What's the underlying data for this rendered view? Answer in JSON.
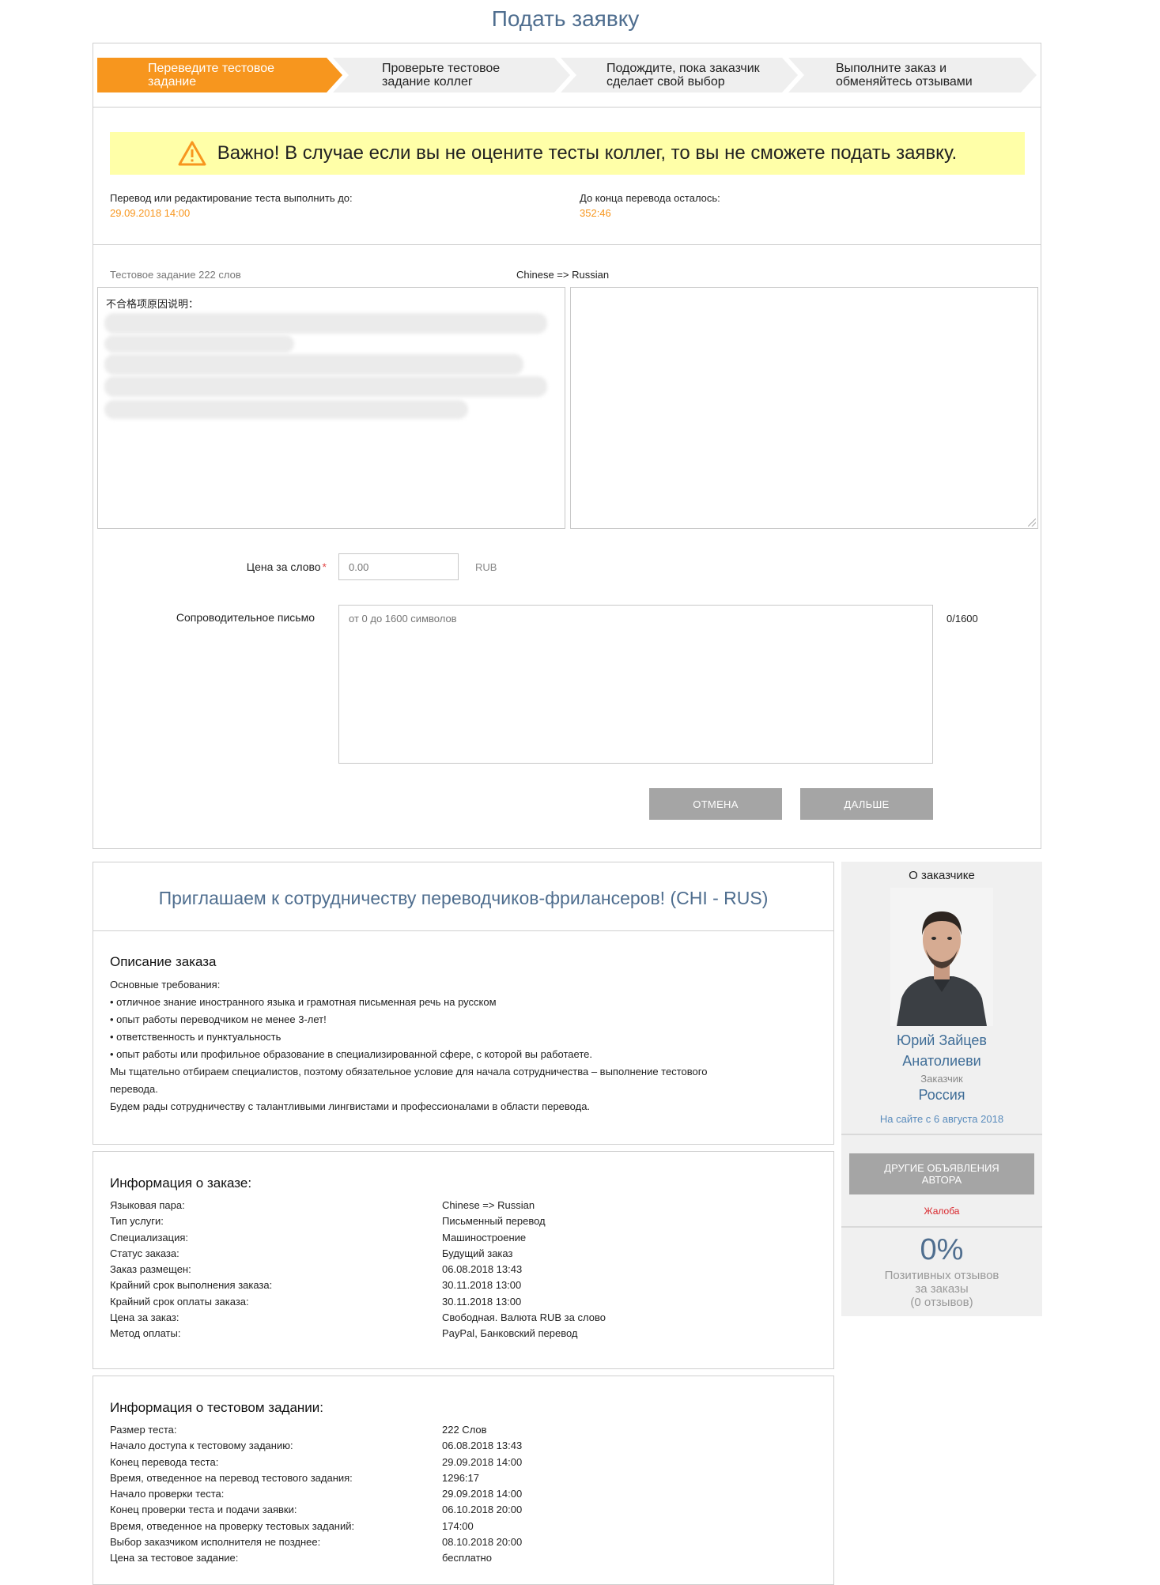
{
  "page_title": "Подать заявку",
  "steps": [
    {
      "line1": "Переведите тестовое",
      "line2": "задание"
    },
    {
      "line1": "Проверьте тестовое",
      "line2": "задание коллег"
    },
    {
      "line1": "Подождите, пока заказчик",
      "line2": "сделает свой выбор"
    },
    {
      "line1": "Выполните заказ и",
      "line2": "обменяйтесь отзывами"
    }
  ],
  "alert_text": "Важно! В случае если вы не оцените тесты коллег, то вы не сможете подать заявку.",
  "deadline": {
    "label": "Перевод или редактирование теста выполнить до:",
    "value": "29.09.2018 14:00",
    "remaining_label": "До конца перевода осталось:",
    "remaining_value": "352:46"
  },
  "test": {
    "words_label": "Тестовое задание 222 слов",
    "language_pair": "Chinese => Russian",
    "source_first_line": "不合格项原因说明："
  },
  "form": {
    "price_label": "Цена за слово",
    "required_mark": "*",
    "price_placeholder": "0.00",
    "currency": "RUB",
    "letter_label": "Сопроводительное письмо",
    "letter_placeholder": "от 0 до 1600 символов",
    "counter": "0/1600",
    "cancel_label": "ОТМЕНА",
    "next_label": "ДАЛЬШЕ"
  },
  "job": {
    "title": "Приглашаем к сотрудничеству переводчиков-фрилансеров! (CHI - RUS)",
    "description_heading": "Описание заказа",
    "description_lines": [
      "Основные требования:",
      "• отличное знание иностранного языка и грамотная письменная речь на русском",
      "• опыт работы переводчиком не менее 3-лет!",
      "• ответственность и пунктуальность",
      "• опыт работы или профильное образование в специализированной сфере, с которой вы работаете.",
      "Мы тщательно отбираем специалистов, поэтому обязательное условие для начала сотрудничества – выполнение тестового",
      "перевода.",
      "Будем рады сотрудничеству с талантливыми лингвистами и профессионалами в области перевода."
    ]
  },
  "order_info": {
    "heading": "Информация о заказе:",
    "rows": [
      {
        "k": "Языковая пара:",
        "v": "Chinese => Russian"
      },
      {
        "k": "Тип услуги:",
        "v": "Письменный перевод"
      },
      {
        "k": "Специализация:",
        "v": "Машиностроение"
      },
      {
        "k": "Статус заказа:",
        "v": "Будущий заказ"
      },
      {
        "k": "Заказ размещен:",
        "v": "06.08.2018 13:43"
      },
      {
        "k": "Крайний срок выполнения заказа:",
        "v": "30.11.2018 13:00"
      },
      {
        "k": "Крайний срок оплаты заказа:",
        "v": "30.11.2018 13:00"
      },
      {
        "k": "Цена за заказ:",
        "v": "Свободная. Валюта RUB за слово"
      },
      {
        "k": "Метод оплаты:",
        "v": "PayPal, Банковский перевод"
      }
    ]
  },
  "test_info": {
    "heading": "Информация о тестовом задании:",
    "rows": [
      {
        "k": "Размер теста:",
        "v": "222 Слов"
      },
      {
        "k": "Начало доступа к тестовому заданию:",
        "v": "06.08.2018 13:43"
      },
      {
        "k": "Конец перевода теста:",
        "v": "29.09.2018 14:00"
      },
      {
        "k": "Время, отведенное на перевод тестового задания:",
        "v": "1296:17"
      },
      {
        "k": "Начало проверки теста:",
        "v": "29.09.2018 14:00"
      },
      {
        "k": "Конец проверки теста и подачи заявки:",
        "v": "06.10.2018 20:00"
      },
      {
        "k": "Время, отведенное на проверку тестовых заданий:",
        "v": "174:00"
      },
      {
        "k": "Выбор заказчиком исполнителя не позднее:",
        "v": "08.10.2018 20:00"
      },
      {
        "k": "Цена за тестовое задание:",
        "v": "бесплатно"
      }
    ]
  },
  "customer": {
    "heading": "О заказчике",
    "first_name": "Юрий Зайцев",
    "second_name": "Анатолиеви",
    "role": "Заказчик",
    "country": "Россия",
    "since": "На сайте с 6 августа 2018",
    "other_ads_label": "ДРУГИЕ ОБЪЯВЛЕНИЯ АВТОРА",
    "complaint_label": "Жалоба",
    "positive_percent": "0%",
    "positive_line1": "Позитивных отзывов",
    "positive_line2": "за заказы",
    "positive_line3": "(0 отзывов)"
  },
  "colors": {
    "accent": "#f7961e",
    "title_blue": "#4f6e8f",
    "alert_bg": "#ffffa8",
    "button_grey": "#a5a5a5",
    "complaint_red": "#d9262c"
  }
}
